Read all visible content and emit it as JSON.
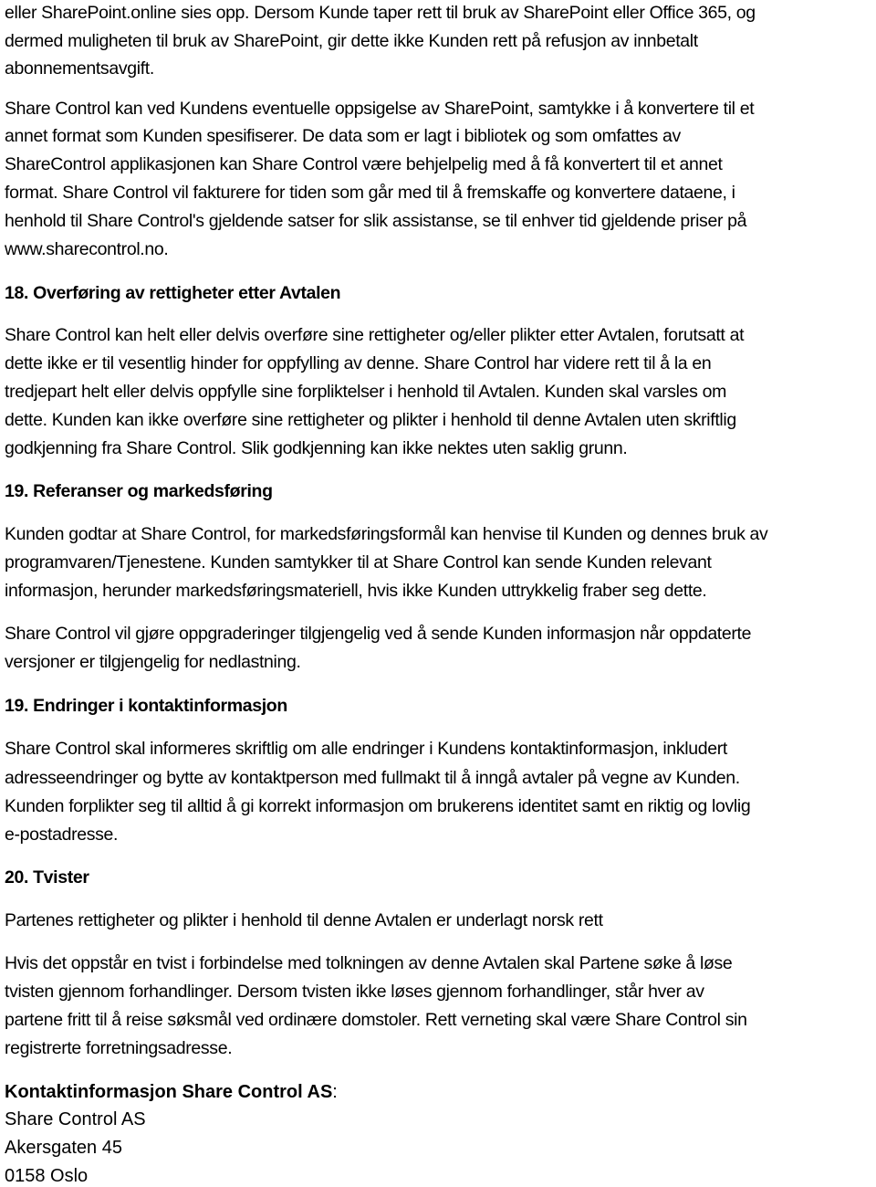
{
  "document": {
    "intro_paragraph": {
      "lines": [
        "eller SharePoint.online sies opp. Dersom Kunde taper rett til bruk av SharePoint eller Office 365, og",
        "dermed muligheten til bruk av SharePoint, gir dette ikke Kunden rett på refusjon av innbetalt",
        "abonnementsavgift."
      ]
    },
    "conversion_paragraph": {
      "lines": [
        "Share Control kan ved Kundens eventuelle oppsigelse av SharePoint, samtykke i å konvertere til et",
        "annet format som Kunden spesifiserer. De data som er lagt i bibliotek og som omfattes av",
        "ShareControl applikasjonen kan Share Control være behjelpelig med å få konvertert til et annet",
        "format. Share Control vil fakturere for tiden som går med til å fremskaffe og konvertere dataene, i",
        "henhold til Share Control's gjeldende satser for slik assistanse, se til enhver tid gjeldende priser på",
        "www.sharecontrol.no."
      ]
    },
    "sections": [
      {
        "heading": "18. Overføring av rettigheter etter Avtalen",
        "paragraphs": [
          {
            "lines": [
              "Share Control kan helt eller delvis overføre sine rettigheter og/eller plikter etter Avtalen, forutsatt at",
              "dette ikke er til vesentlig hinder for oppfylling av denne. Share Control har videre rett til å la en",
              "tredjepart helt eller delvis oppfylle sine forpliktelser i henhold til Avtalen. Kunden skal varsles om",
              "dette. Kunden kan ikke overføre sine rettigheter og plikter i henhold til denne Avtalen uten skriftlig",
              "godkjenning fra Share Control. Slik godkjenning kan ikke nektes uten saklig grunn."
            ]
          }
        ]
      },
      {
        "heading": "19. Referanser og markedsføring",
        "paragraphs": [
          {
            "lines": [
              "Kunden godtar at Share Control, for markedsføringsformål kan henvise til Kunden og dennes bruk av",
              "programvaren/Tjenestene. Kunden samtykker til at Share Control kan sende Kunden relevant",
              "informasjon, herunder markedsføringsmateriell, hvis ikke Kunden uttrykkelig fraber seg dette."
            ]
          },
          {
            "lines": [
              "Share Control vil gjøre oppgraderinger tilgjengelig ved å sende Kunden informasjon når oppdaterte",
              "versjoner er tilgjengelig for nedlastning."
            ]
          }
        ]
      },
      {
        "heading": "19. Endringer i kontaktinformasjon",
        "paragraphs": [
          {
            "lines": [
              "Share Control skal informeres skriftlig om alle endringer i Kundens kontaktinformasjon, inkludert",
              "adresseendringer og bytte av kontaktperson med fullmakt til å inngå avtaler på vegne av Kunden.",
              "Kunden forplikter seg til alltid å gi korrekt informasjon om brukerens identitet samt en riktig og lovlig",
              "e-postadresse."
            ]
          }
        ]
      },
      {
        "heading": "20. Tvister",
        "paragraphs": [
          {
            "lines": [
              "Partenes rettigheter og plikter i henhold til denne Avtalen er underlagt norsk rett"
            ]
          },
          {
            "lines": [
              "Hvis det oppstår en tvist i forbindelse med tolkningen av denne Avtalen skal Partene søke å løse",
              "tvisten gjennom forhandlinger. Dersom tvisten ikke løses gjennom forhandlinger, står hver av",
              "partene fritt til å reise søksmål ved ordinære domstoler. Rett verneting skal være Share Control sin",
              "registrerte forretningsadresse."
            ]
          }
        ]
      }
    ],
    "contact": {
      "heading": "Kontaktinformasjon Share Control AS",
      "heading_suffix": ":",
      "company": "Share Control AS",
      "street": "Akersgaten 45",
      "postal": "0158 Oslo"
    }
  }
}
